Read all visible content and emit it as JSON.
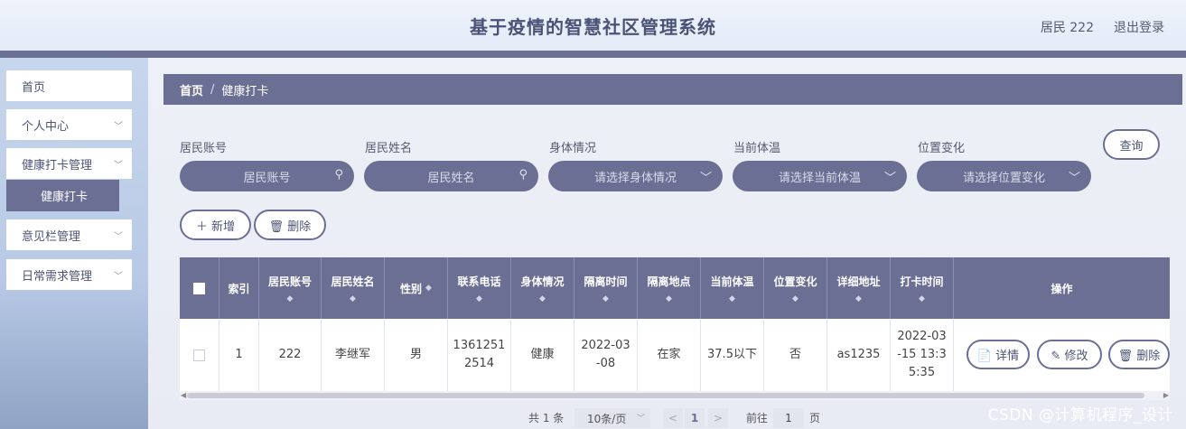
{
  "header": {
    "title": "基于疫情的智慧社区管理系统",
    "user": "居民 222",
    "logout": "退出登录"
  },
  "sidebar": {
    "items": [
      {
        "label": "首页",
        "chevron": ""
      },
      {
        "label": "个人中心",
        "chevron": "﹀"
      },
      {
        "label": "健康打卡管理",
        "chevron": "﹀"
      },
      {
        "label": "意见栏管理",
        "chevron": "﹀"
      },
      {
        "label": "日常需求管理",
        "chevron": "﹀"
      }
    ],
    "active_sub": "健康打卡"
  },
  "breadcrumb": {
    "home": "首页",
    "sep": "/",
    "current": "健康打卡"
  },
  "filters": [
    {
      "label": "居民账号",
      "placeholder": "居民账号",
      "icon": "search-icon"
    },
    {
      "label": "居民姓名",
      "placeholder": "居民姓名",
      "icon": "search-icon"
    },
    {
      "label": "身体情况",
      "placeholder": "请选择身体情况",
      "icon": "chevron-down-icon"
    },
    {
      "label": "当前体温",
      "placeholder": "请选择当前体温",
      "icon": "chevron-down-icon"
    },
    {
      "label": "位置变化",
      "placeholder": "请选择位置变化",
      "icon": "chevron-down-icon"
    }
  ],
  "actions": {
    "query": "查询",
    "add": "＋ 新增",
    "delete": "🗑 删除"
  },
  "table": {
    "columns": [
      "",
      "索引",
      "居民账号",
      "居民姓名",
      "性别",
      "联系电话",
      "身体情况",
      "隔离时间",
      "隔离地点",
      "当前体温",
      "位置变化",
      "详细地址",
      "打卡时间",
      "操作"
    ],
    "sort_mark": "◆",
    "rows": [
      {
        "cells": [
          "",
          "1",
          "222",
          "李继军",
          "男",
          "1361251\n2514",
          "健康",
          "2022-03\n-08",
          "在家",
          "37.5以下",
          "否",
          "as1235",
          "2022-03\n-15 13:3\n5:35"
        ],
        "ops": [
          "📄 详情",
          "✎ 修改",
          "🗑 删除"
        ]
      }
    ]
  },
  "pagination": {
    "total": "共 1 条",
    "page_size": "10条/页",
    "prev": "<",
    "current": "1",
    "next": ">",
    "goto": "前往",
    "goto_value": "1",
    "page_unit": "页"
  },
  "watermark": "CSDN @计算机程序_设计",
  "colors": {
    "accent": "#6b6f94",
    "sidebar": "#c7d6ec"
  }
}
